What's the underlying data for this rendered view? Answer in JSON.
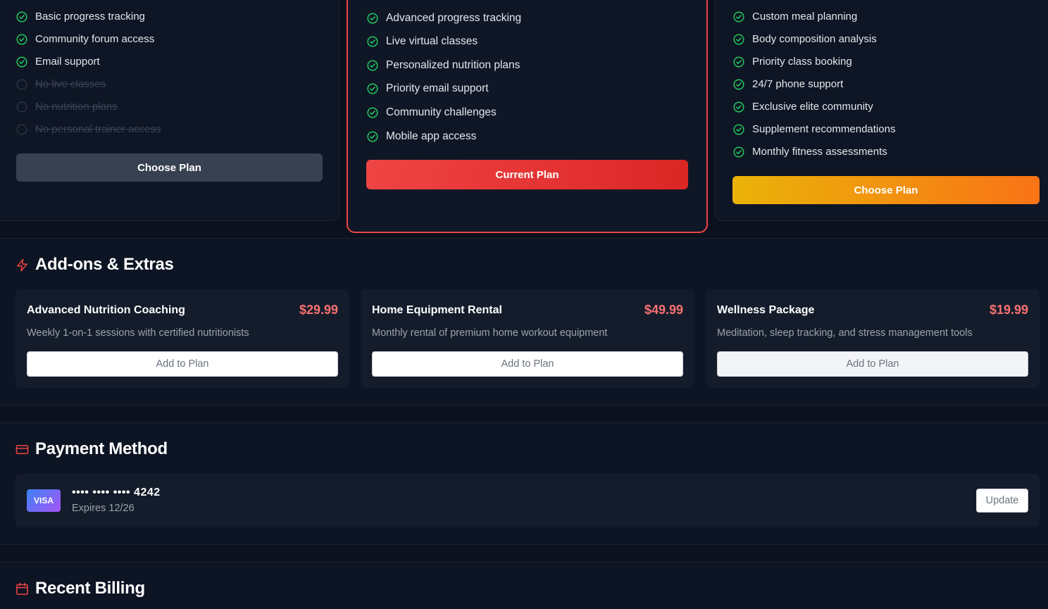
{
  "plans": {
    "basic": {
      "features": [
        {
          "label": "Basic progress tracking",
          "included": true
        },
        {
          "label": "Community forum access",
          "included": true
        },
        {
          "label": "Email support",
          "included": true
        },
        {
          "label": "No live classes",
          "included": false
        },
        {
          "label": "No nutrition plans",
          "included": false
        },
        {
          "label": "No personal trainer access",
          "included": false
        }
      ],
      "button_label": "Choose Plan"
    },
    "pro": {
      "features": [
        {
          "label": "Advanced progress tracking",
          "included": true
        },
        {
          "label": "Live virtual classes",
          "included": true
        },
        {
          "label": "Personalized nutrition plans",
          "included": true
        },
        {
          "label": "Priority email support",
          "included": true
        },
        {
          "label": "Community challenges",
          "included": true
        },
        {
          "label": "Mobile app access",
          "included": true
        }
      ],
      "button_label": "Current Plan"
    },
    "elite": {
      "features": [
        {
          "label": "Custom meal planning",
          "included": true
        },
        {
          "label": "Body composition analysis",
          "included": true
        },
        {
          "label": "Priority class booking",
          "included": true
        },
        {
          "label": "24/7 phone support",
          "included": true
        },
        {
          "label": "Exclusive elite community",
          "included": true
        },
        {
          "label": "Supplement recommendations",
          "included": true
        },
        {
          "label": "Monthly fitness assessments",
          "included": true
        }
      ],
      "button_label": "Choose Plan"
    }
  },
  "addons": {
    "title": "Add-ons & Extras",
    "icon": "lightning-icon",
    "items": [
      {
        "name": "Advanced Nutrition Coaching",
        "price": "$29.99",
        "description": "Weekly 1-on-1 sessions with certified nutritionists",
        "button_label": "Add to Plan"
      },
      {
        "name": "Home Equipment Rental",
        "price": "$49.99",
        "description": "Monthly rental of premium home workout equipment",
        "button_label": "Add to Plan"
      },
      {
        "name": "Wellness Package",
        "price": "$19.99",
        "description": "Meditation, sleep tracking, and stress management tools",
        "button_label": "Add to Plan"
      }
    ]
  },
  "payment": {
    "title": "Payment Method",
    "icon": "credit-card-icon",
    "brand": "VISA",
    "card_number": "•••• •••• •••• 4242",
    "expires": "Expires 12/26",
    "update_label": "Update"
  },
  "billing": {
    "title": "Recent Billing",
    "icon": "calendar-icon"
  },
  "colors": {
    "accent_red": "#ef4444",
    "check_green": "#22c55e",
    "price_red": "#f87171",
    "elite_gradient_start": "#eab308",
    "elite_gradient_end": "#f97316",
    "background": "#0b111d"
  }
}
